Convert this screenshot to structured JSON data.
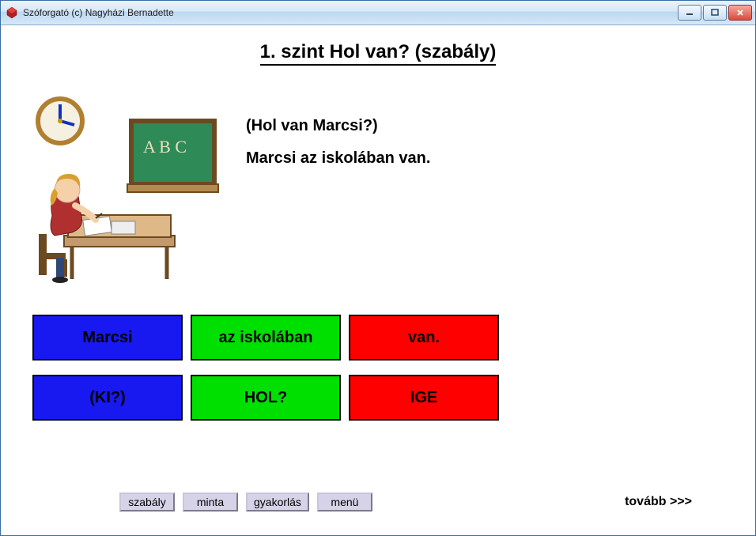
{
  "window": {
    "title": "Szóforgató (c) Nagyházi Bernadette"
  },
  "heading": "1. szint   Hol van? (szabály)",
  "example": {
    "line1": "(Hol van Marcsi?)",
    "line2": "Marcsi az iskolában van."
  },
  "word_rows": [
    {
      "cells": [
        {
          "text": "Marcsi",
          "color": "blue"
        },
        {
          "text": "az iskolában",
          "color": "green"
        },
        {
          "text": "van.",
          "color": "red"
        }
      ]
    },
    {
      "cells": [
        {
          "text": "(KI?)",
          "color": "blue"
        },
        {
          "text": "HOL?",
          "color": "green"
        },
        {
          "text": "IGE",
          "color": "red"
        }
      ]
    }
  ],
  "nav": {
    "szabaly": "szabály",
    "minta": "minta",
    "gyakorlas": "gyakorlás",
    "menu": "menü",
    "tovabb": "tovább >>>"
  },
  "illustration": {
    "desc": "classroom-scene"
  }
}
